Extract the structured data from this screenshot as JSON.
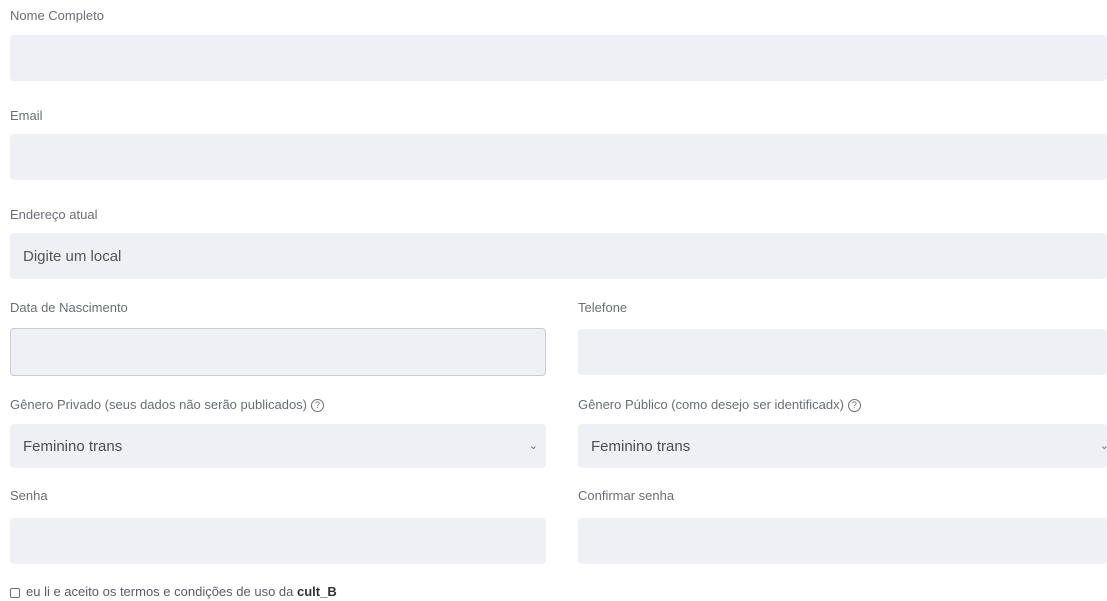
{
  "form": {
    "full_name": {
      "label": "Nome Completo",
      "value": ""
    },
    "email": {
      "label": "Email",
      "value": ""
    },
    "address": {
      "label": "Endereço atual",
      "placeholder": "Digite um local"
    },
    "birth_date": {
      "label": "Data de Nascimento",
      "value": ""
    },
    "phone": {
      "label": "Telefone",
      "value": ""
    },
    "gender_private": {
      "label": "Gênero Privado (seus dados não serão publicados)",
      "selected": "Feminino trans"
    },
    "gender_public": {
      "label": "Gênero Público (como desejo ser identificadx)",
      "selected": "Feminino trans"
    },
    "password": {
      "label": "Senha",
      "value": ""
    },
    "password_confirm": {
      "label": "Confirmar senha",
      "value": ""
    },
    "terms": {
      "text": "eu li e aceito os termos e condições de uso da",
      "brand": "cult_B",
      "checked": false
    }
  },
  "icons": {
    "help": "question-circle-icon",
    "chevron": "chevron-down-icon"
  }
}
